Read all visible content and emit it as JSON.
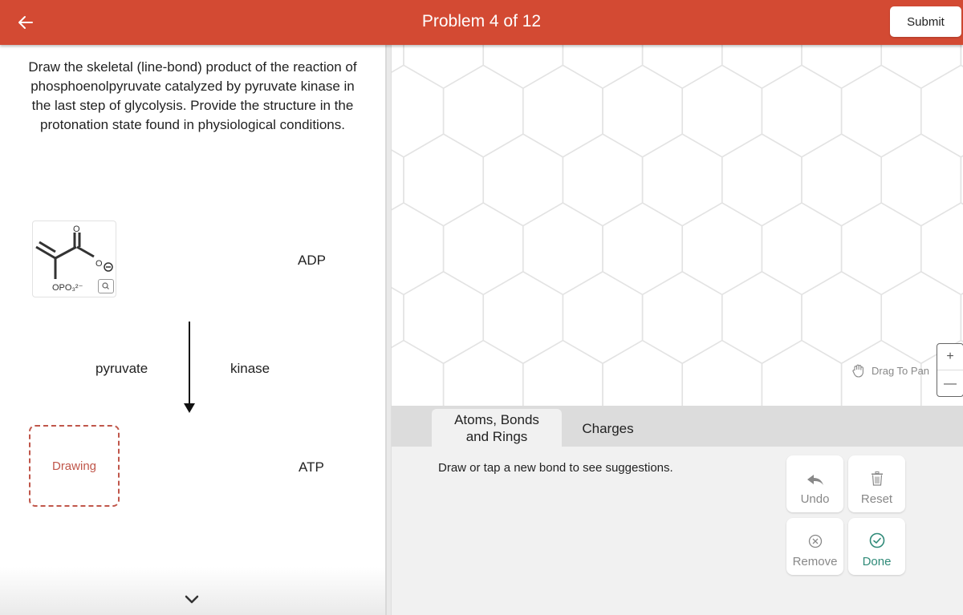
{
  "header": {
    "back_icon": "arrow-left-icon",
    "title": "Problem 4 of 12",
    "submit_label": "Submit",
    "brand_color": "#d34a33"
  },
  "question": {
    "prompt": "Draw the skeletal (line-bond) product of the reaction of phosphoenolpyruvate catalyzed by pyruvate kinase in the last step of glycolysis. Provide the structure in the protonation state found in physiological conditions."
  },
  "reaction": {
    "reactant_label_group": "OPO₃²⁻",
    "reactant_carbonyl_o": "O",
    "reactant_carboxylate_o": "O",
    "reactant_charge": "⊖",
    "zoom_icon": "magnifier-icon",
    "above_arrow": "ADP",
    "left_of_arrow": "pyruvate",
    "right_of_arrow": "kinase",
    "below_arrow": "ATP",
    "product_placeholder": "Drawing",
    "placeholder_color": "#c0564a"
  },
  "canvas": {
    "pan_hint": "Drag To Pan",
    "zoom_in": "+",
    "zoom_out": "—"
  },
  "toolbox": {
    "tabs": [
      {
        "label_line1": "Atoms, Bonds",
        "label_line2": "and Rings",
        "active": true
      },
      {
        "label": "Charges",
        "active": false
      }
    ],
    "hint": "Draw or tap a new bond to see suggestions.",
    "buttons": {
      "undo": "Undo",
      "reset": "Reset",
      "remove": "Remove",
      "done": "Done"
    },
    "done_color": "#2f8a78"
  }
}
